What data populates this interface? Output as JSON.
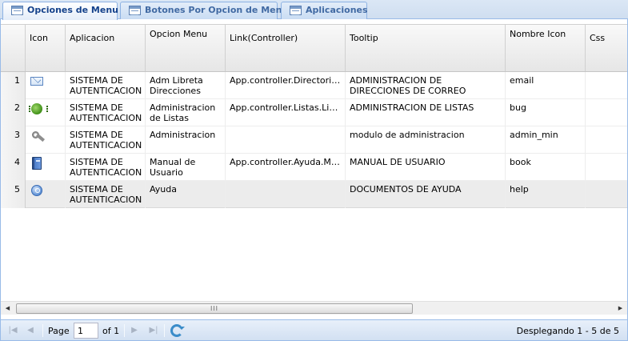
{
  "tabs": [
    {
      "label": "Opciones de Menu",
      "active": true
    },
    {
      "label": "Botones Por Opcion de Menu",
      "active": false
    },
    {
      "label": "Aplicaciones",
      "active": false
    }
  ],
  "grid": {
    "columns": [
      "Icon",
      "Aplicacion",
      "Opcion Menu",
      "Link(Controller)",
      "Tooltip",
      "Nombre Icon",
      "Css"
    ],
    "rows": [
      {
        "num": "1",
        "icon": "email-icon",
        "aplicacion": "SISTEMA DE AUTENTICACION",
        "opcion": "Adm Libreta Direcciones",
        "link": "App.controller.Directorios.Directorios",
        "tooltip": "ADMINISTRACION DE DIRECCIONES DE CORREO",
        "nombre_icon": "email",
        "css": ""
      },
      {
        "num": "2",
        "icon": "bug-icon",
        "aplicacion": "SISTEMA DE AUTENTICACION",
        "opcion": "Administracion de Listas",
        "link": "App.controller.Listas.Listas",
        "tooltip": "ADMINISTRACION DE LISTAS",
        "nombre_icon": "bug",
        "css": ""
      },
      {
        "num": "3",
        "icon": "admin-icon",
        "aplicacion": "SISTEMA DE AUTENTICACION",
        "opcion": "Administracion",
        "link": "",
        "tooltip": "modulo de administracion",
        "nombre_icon": "admin_min",
        "css": ""
      },
      {
        "num": "4",
        "icon": "book-icon",
        "aplicacion": "SISTEMA DE AUTENTICACION",
        "opcion": "Manual de Usuario",
        "link": "App.controller.Ayuda.Manual",
        "tooltip": "MANUAL DE USUARIO",
        "nombre_icon": "book",
        "css": ""
      },
      {
        "num": "5",
        "icon": "help-icon",
        "aplicacion": "SISTEMA DE AUTENTICACION",
        "opcion": "Ayuda",
        "link": "",
        "tooltip": "DOCUMENTOS DE AYUDA",
        "nombre_icon": "help",
        "css": ""
      }
    ]
  },
  "scrollbar": {
    "thumb_grip": "III"
  },
  "pager": {
    "page_label": "Page",
    "page_value": "1",
    "of_label": "of 1",
    "status": "Desplegando 1 - 5 de 5"
  }
}
